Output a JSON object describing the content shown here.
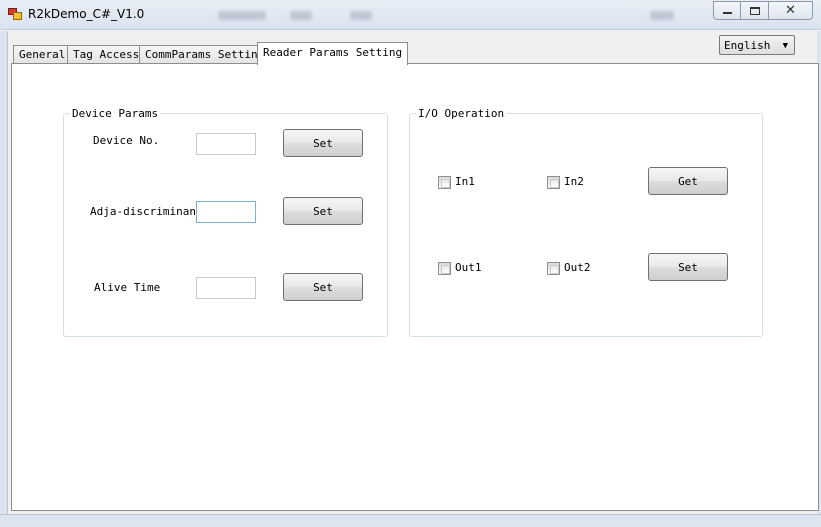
{
  "window": {
    "title": "R2kDemo_C#_V1.0",
    "icon": "app-icon",
    "controls": [
      "minimize-icon",
      "maximize-icon",
      "close-icon"
    ],
    "close_glyph": "✕"
  },
  "tabs": [
    {
      "label": "General"
    },
    {
      "label": "Tag Access"
    },
    {
      "label": "CommParams Setting"
    },
    {
      "label": "Reader Params Setting",
      "active": true
    }
  ],
  "language": {
    "selected": "English",
    "arrow": "▼"
  },
  "device_params": {
    "legend": "Device Params",
    "device_no": {
      "label": "Device No.",
      "value": "",
      "button": "Set"
    },
    "adja": {
      "label": "Adja-discriminant",
      "value": "",
      "button": "Set"
    },
    "alive_time": {
      "label": "Alive Time",
      "value": "",
      "button": "Set"
    }
  },
  "io_operation": {
    "legend": "I/O Operation",
    "inputs": [
      {
        "label": "In1",
        "checked": false
      },
      {
        "label": "In2",
        "checked": false
      }
    ],
    "get_button": "Get",
    "outputs": [
      {
        "label": "Out1",
        "checked": false
      },
      {
        "label": "Out2",
        "checked": false
      }
    ],
    "set_button": "Set"
  }
}
